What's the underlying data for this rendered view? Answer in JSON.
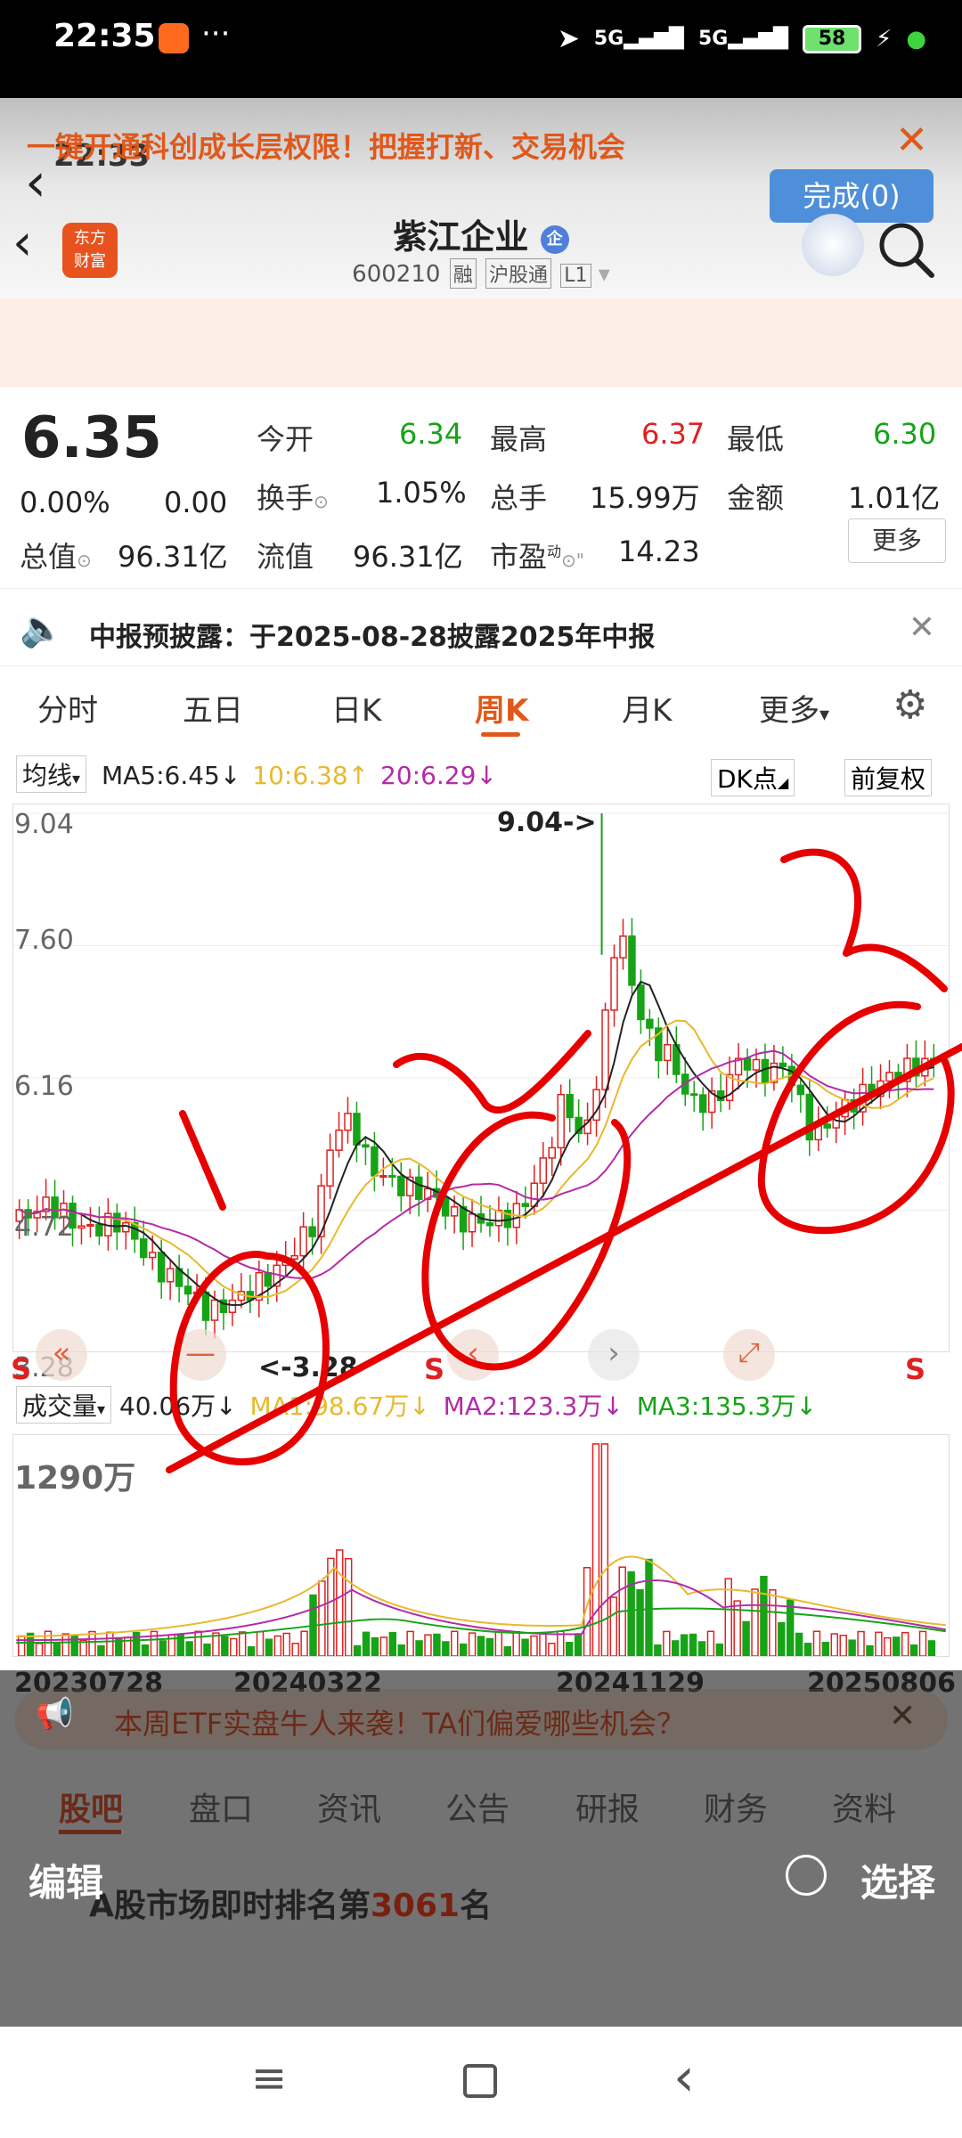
{
  "outer_status": {
    "time": "22:35",
    "signal1": "5G",
    "signal2": "5G",
    "battery": "58"
  },
  "inner_status": {
    "time": "22:33",
    "battery": "58"
  },
  "header": {
    "done_label": "完成(0)",
    "brand_line1": "东方",
    "brand_line2": "财富",
    "stock_name": "紫江企业",
    "stock_code": "600210",
    "tags": [
      "融",
      "沪股通",
      "L1"
    ]
  },
  "banner": {
    "text": "一键开通科创成长层权限！把握打新、交易机会"
  },
  "quote": {
    "price": "6.35",
    "change_pct": "0.00%",
    "change": "0.00",
    "open_label": "今开",
    "open": "6.34",
    "high_label": "最高",
    "high": "6.37",
    "low_label": "最低",
    "low": "6.30",
    "turnover_label": "换手",
    "turnover": "1.05%",
    "volume_label": "总手",
    "volume": "15.99万",
    "amount_label": "金额",
    "amount": "1.01亿",
    "mktcap_label": "总值",
    "mktcap": "96.31亿",
    "float_label": "流值",
    "float": "96.31亿",
    "pe_label": "市盈",
    "pe_sup": "动",
    "pe": "14.23",
    "more_label": "更多"
  },
  "notice": {
    "text": "中报预披露：于2025-08-28披露2025年中报"
  },
  "tabs": [
    "分时",
    "五日",
    "日K",
    "周K",
    "月K",
    "更多"
  ],
  "active_tab": "周K",
  "ma": {
    "selector": "均线",
    "ma5": "MA5:6.45",
    "ma10": "10:6.38",
    "ma20": "20:6.29",
    "dk": "DK点",
    "adjust": "前复权"
  },
  "chart_data": {
    "type": "candlestick",
    "y_ticks": [
      "9.04",
      "7.60",
      "6.16",
      "4.72",
      "3.28"
    ],
    "ylim": [
      3.28,
      9.04
    ],
    "max_label": "9.04->",
    "min_label": "<-3.28",
    "x_ticks": [
      "20230728",
      "20240322",
      "20241129",
      "20250806"
    ],
    "volume_label": "成交量",
    "volume_value": "40.06万",
    "vol_ma1": "MA1:98.67万",
    "vol_ma2": "MA2:123.3万",
    "vol_ma3": "MA3:135.3万",
    "vol_max": "1290万",
    "marker_s": "S",
    "colors": {
      "up": "#e02020",
      "down": "#17a317",
      "ma5": "#222222",
      "ma10": "#e8b92c",
      "ma20": "#b32ba8"
    }
  },
  "lower": {
    "etf_banner": "本周ETF实盘牛人来袭！TA们偏爱哪些机会？",
    "sub_tabs": [
      "股吧",
      "盘口",
      "资讯",
      "公告",
      "研报",
      "财务",
      "资料"
    ],
    "rank_prefix": "A股市场即时排名第",
    "rank_value": "3061",
    "rank_suffix": "名"
  },
  "overlay": {
    "edit_label": "编辑",
    "select_label": "选择"
  }
}
